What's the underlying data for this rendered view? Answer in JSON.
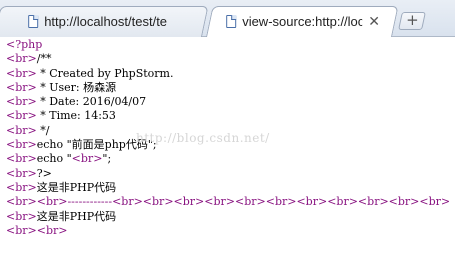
{
  "tabs": [
    {
      "title": "http://localhost/test/te",
      "active": false
    },
    {
      "title": "view-source:http://loca",
      "active": true,
      "close": "✕"
    }
  ],
  "new_tab_label": "+",
  "source_lines": [
    {
      "parts": [
        {
          "t": "<?php",
          "tag": true
        }
      ]
    },
    {
      "parts": [
        {
          "t": "<br>",
          "tag": true
        },
        {
          "t": "/**",
          "tag": false
        }
      ]
    },
    {
      "parts": [
        {
          "t": "<br>",
          "tag": true
        },
        {
          "t": " * Created by PhpStorm.",
          "tag": false
        }
      ]
    },
    {
      "parts": [
        {
          "t": "<br>",
          "tag": true
        },
        {
          "t": " * User: 杨森源",
          "tag": false
        }
      ]
    },
    {
      "parts": [
        {
          "t": "<br>",
          "tag": true
        },
        {
          "t": " * Date: 2016/04/07",
          "tag": false
        }
      ]
    },
    {
      "parts": [
        {
          "t": "<br>",
          "tag": true
        },
        {
          "t": " * Time: 14:53",
          "tag": false
        }
      ]
    },
    {
      "parts": [
        {
          "t": "<br>",
          "tag": true
        },
        {
          "t": " */",
          "tag": false
        }
      ]
    },
    {
      "parts": [
        {
          "t": "<br>",
          "tag": true
        },
        {
          "t": "echo \"前面是php代码\";",
          "tag": false
        }
      ]
    },
    {
      "parts": [
        {
          "t": "<br>",
          "tag": true
        },
        {
          "t": "echo \"",
          "tag": false
        },
        {
          "t": "<br>",
          "tag": true
        },
        {
          "t": "\";",
          "tag": false
        }
      ]
    },
    {
      "parts": [
        {
          "t": "<br>",
          "tag": true
        },
        {
          "t": "?>",
          "tag": false
        }
      ]
    },
    {
      "parts": [
        {
          "t": "<br>",
          "tag": true
        },
        {
          "t": "这是非PHP代码",
          "tag": false
        }
      ]
    },
    {
      "parts": [
        {
          "t": "<br><br>------------<br><br><br><br><br><br><br><br><br><br><br>",
          "tag": true
        }
      ]
    },
    {
      "parts": [
        {
          "t": "<br>",
          "tag": true
        },
        {
          "t": "这是非PHP代码",
          "tag": false
        }
      ]
    },
    {
      "parts": [
        {
          "t": "<br><br>",
          "tag": true
        }
      ]
    }
  ],
  "watermark": "http://blog.csdn.net/"
}
